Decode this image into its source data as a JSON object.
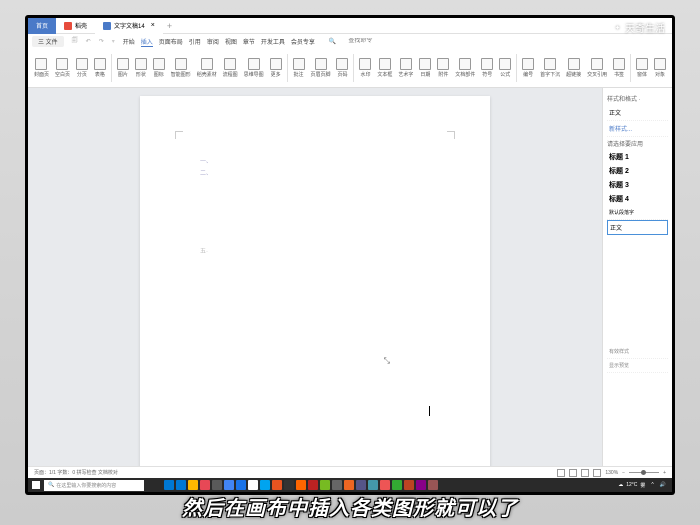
{
  "watermark": "天奇生活",
  "tabs": [
    {
      "label": "首页",
      "kind": "home"
    },
    {
      "label": "稻壳",
      "kind": "app"
    },
    {
      "label": "文字文稿14",
      "kind": "doc"
    }
  ],
  "menubar": {
    "file": "三 文件",
    "items": [
      "开始",
      "插入",
      "页面布局",
      "引用",
      "审阅",
      "视图",
      "章节",
      "开发工具",
      "会员专享"
    ],
    "active": "插入",
    "search_placeholder": "查找命令"
  },
  "ribbon": [
    {
      "label": "封面页"
    },
    {
      "label": "空白页"
    },
    {
      "label": "分页"
    },
    {
      "label": "表格"
    },
    {
      "label": "图片"
    },
    {
      "label": "形状"
    },
    {
      "label": "图标"
    },
    {
      "label": "智能图形"
    },
    {
      "label": "稻壳素材"
    },
    {
      "label": "流程图"
    },
    {
      "label": "思维导图"
    },
    {
      "label": "更多"
    },
    {
      "label": "批注"
    },
    {
      "label": "页眉页脚"
    },
    {
      "label": "页码"
    },
    {
      "label": "水印"
    },
    {
      "label": "文本框"
    },
    {
      "label": "艺术字"
    },
    {
      "label": "日期"
    },
    {
      "label": "附件"
    },
    {
      "label": "文档部件"
    },
    {
      "label": "符号"
    },
    {
      "label": "公式"
    },
    {
      "label": "编号"
    },
    {
      "label": "首字下沉"
    },
    {
      "label": "超链接"
    },
    {
      "label": "交叉引用"
    },
    {
      "label": "书签"
    },
    {
      "label": "窗体"
    },
    {
      "label": "对象"
    }
  ],
  "page_marks": {
    "one": "一、",
    "two": "二、",
    "era": "五·"
  },
  "side_panel": {
    "title": "样式和格式 ·",
    "current": "正文",
    "new_style": "新样式...",
    "apply_label": "请选择要应用",
    "styles": [
      "标题 1",
      "标题 2",
      "标题 3",
      "标题 4"
    ],
    "default_font": "默认段落字",
    "normal": "正文",
    "footer1": "有效样式",
    "footer2": "显示预览"
  },
  "statusbar": {
    "left": "页面：1/1  字数：0  拼写检查  文档校对",
    "zoom": "130%"
  },
  "taskbar": {
    "search_placeholder": "在这里输入你要搜索的内容",
    "weather": "12°C",
    "weather_desc": "雾",
    "colors": [
      "#0078d4",
      "#0078d4",
      "#ffb900",
      "#e74856",
      "#5a5a5a",
      "#4285f4",
      "#1a73e8",
      "#fff",
      "#00a4ef",
      "#e95420",
      "#333",
      "#ff6600",
      "#bb2222",
      "#7b2",
      "#666",
      "#e62",
      "#558",
      "#49a",
      "#e55",
      "#3a3",
      "#b42",
      "#808",
      "#955"
    ]
  },
  "subtitle": "然后在画布中插入各类图形就可以了"
}
